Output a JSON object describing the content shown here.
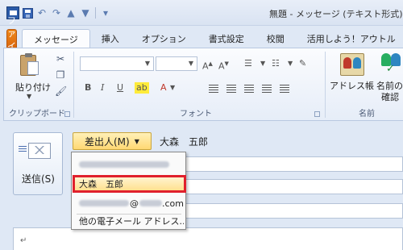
{
  "window": {
    "title": "無題 - メッセージ (テキスト形式)"
  },
  "quick_access": {
    "icons": [
      "outlook-icon",
      "save-icon",
      "undo-icon",
      "redo-icon",
      "up-icon",
      "down-icon",
      "customize-icon"
    ]
  },
  "tabs": [
    {
      "label": "ファイル",
      "kind": "file"
    },
    {
      "label": "メッセージ",
      "active": true
    },
    {
      "label": "挿入"
    },
    {
      "label": "オプション"
    },
    {
      "label": "書式設定"
    },
    {
      "label": "校閲"
    },
    {
      "label": "活用しよう！アウトル"
    }
  ],
  "ribbon": {
    "clipboard": {
      "paste_label": "貼り付け",
      "group_label": "クリップボード"
    },
    "font": {
      "group_label": "フォント",
      "bold": "B",
      "italic": "I",
      "underline": "U"
    },
    "names": {
      "address_book": "アドレス帳",
      "check_names_line1": "名前の",
      "check_names_line2": "確認",
      "group_label": "名前"
    }
  },
  "compose": {
    "send_label": "送信(S)",
    "from_button_label": "差出人(M)",
    "from_name": "大森　五郎",
    "body_marker": "↵"
  },
  "from_menu": {
    "items": [
      {
        "kind": "redacted"
      },
      {
        "label": "大森　五郎",
        "highlighted": true
      },
      {
        "kind": "redacted_email",
        "domain_suffix": ".com"
      },
      {
        "label": "他の電子メール アドレス..."
      }
    ]
  },
  "colors": {
    "file_tab": "#e07310",
    "highlight_border": "#e0202c",
    "from_button": "#ffd873"
  }
}
